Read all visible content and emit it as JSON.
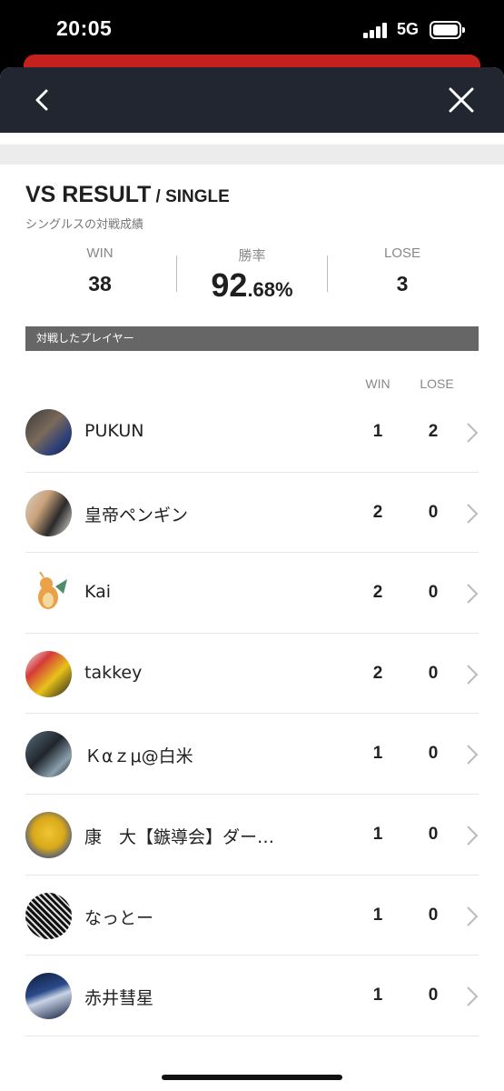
{
  "status_bar": {
    "time": "20:05",
    "network": "5G"
  },
  "header": {
    "title_main": "VS RESULT",
    "title_sub": "/ SINGLE",
    "subtitle": "シングルスの対戦成績"
  },
  "stats": {
    "win_label": "WIN",
    "win_value": "38",
    "rate_label": "勝率",
    "rate_int": "92",
    "rate_dec": ".68%",
    "lose_label": "LOSE",
    "lose_value": "3"
  },
  "section": {
    "title": "対戦したプレイヤー",
    "col_win": "WIN",
    "col_lose": "LOSE"
  },
  "players": [
    {
      "name": "PUKUN",
      "win": "1",
      "lose": "2"
    },
    {
      "name": "皇帝ペンギン",
      "win": "2",
      "lose": "0"
    },
    {
      "name": "Kai",
      "win": "2",
      "lose": "0"
    },
    {
      "name": "takkey",
      "win": "2",
      "lose": "0"
    },
    {
      "name": "Ｋαｚμ@白米",
      "win": "1",
      "lose": "0"
    },
    {
      "name": "康　大【鏃導会】ダー…",
      "win": "1",
      "lose": "0"
    },
    {
      "name": "なっとー",
      "win": "1",
      "lose": "0"
    },
    {
      "name": "赤井彗星",
      "win": "1",
      "lose": "0"
    }
  ],
  "icons": {
    "back": "chevron-left-icon",
    "close": "close-icon",
    "row_arrow": "chevron-right-icon"
  },
  "colors": {
    "nav": "#212631",
    "accent_red": "#c4211e",
    "section_bar": "#666666"
  }
}
